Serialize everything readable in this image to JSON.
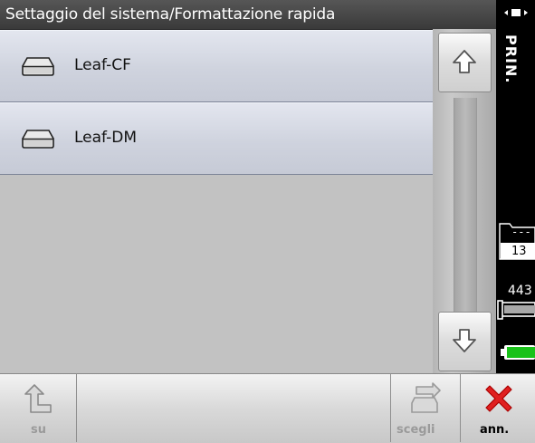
{
  "title": "Settaggio del sistema/Formattazione rapida",
  "items": [
    {
      "label": "Leaf-CF",
      "icon": "drive-icon"
    },
    {
      "label": "Leaf-DM",
      "icon": "drive-icon"
    }
  ],
  "sidebar": {
    "mode_label": "PRIN.",
    "folder_top": "---",
    "folder_bottom": "13",
    "count": "443"
  },
  "bottom": {
    "up_label": "su",
    "choose_label": "scegli",
    "cancel_label": "ann."
  },
  "colors": {
    "battery": "#19c219",
    "cancel_x": "#e02020"
  }
}
